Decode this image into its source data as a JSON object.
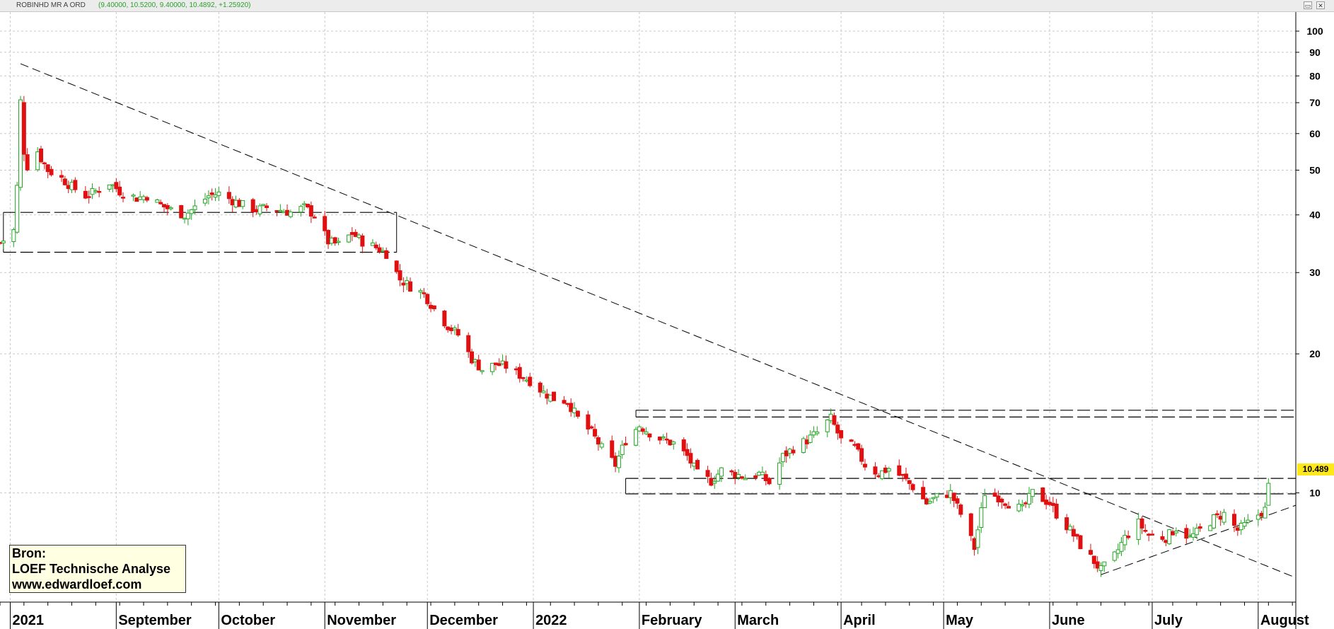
{
  "header": {
    "instrument": "ROBINHD MR A ORD",
    "ohlc_text": "(9.40000, 10.5200, 9.40000, 10.4892, +1.25920)"
  },
  "window_controls": {
    "restore": "▭",
    "close": "✕"
  },
  "source_box": {
    "line1": "Bron:",
    "line2": "LOEF Technische Analyse",
    "line3": "www.edwardloef.com"
  },
  "price_badge": "10.489",
  "colors": {
    "up": "#22a722",
    "down": "#e01010",
    "grid": "#c8c8c8",
    "annotation": "#000000",
    "badge": "#ffe81a",
    "source_bg": "#ffffe1"
  },
  "chart_data": {
    "type": "candlestick",
    "y_scale": "log",
    "ylim": [
      5.8,
      110
    ],
    "y_ticks": [
      {
        "value": 100,
        "label": "100"
      },
      {
        "value": 90,
        "label": "90"
      },
      {
        "value": 80,
        "label": "80"
      },
      {
        "value": 70,
        "label": "70"
      },
      {
        "value": 60,
        "label": "60"
      },
      {
        "value": 50,
        "label": "50"
      },
      {
        "value": 40,
        "label": "40"
      },
      {
        "value": 30,
        "label": "30"
      },
      {
        "value": 20,
        "label": "20"
      },
      {
        "value": 10,
        "label": "10"
      }
    ],
    "x_range": [
      "2021-07-29",
      "2022-08-12"
    ],
    "x_labels": [
      {
        "date": "2021-08-01",
        "label": "2021"
      },
      {
        "date": "2021-09-01",
        "label": "September"
      },
      {
        "date": "2021-10-01",
        "label": "October"
      },
      {
        "date": "2021-11-01",
        "label": "November"
      },
      {
        "date": "2021-12-01",
        "label": "December"
      },
      {
        "date": "2022-01-01",
        "label": "2022"
      },
      {
        "date": "2022-02-01",
        "label": "February"
      },
      {
        "date": "2022-03-01",
        "label": "March"
      },
      {
        "date": "2022-04-01",
        "label": "April"
      },
      {
        "date": "2022-05-01",
        "label": "May"
      },
      {
        "date": "2022-06-01",
        "label": "June"
      },
      {
        "date": "2022-07-01",
        "label": "July"
      },
      {
        "date": "2022-08-01",
        "label": "August"
      }
    ],
    "close_path": [
      [
        "2021-07-29",
        34.8
      ],
      [
        "2021-07-30",
        35.2
      ],
      [
        "2021-08-02",
        37.0
      ],
      [
        "2021-08-03",
        46.0
      ],
      [
        "2021-08-04",
        70.4
      ],
      [
        "2021-08-05",
        55.0
      ],
      [
        "2021-08-06",
        51.0
      ],
      [
        "2021-08-09",
        55.0
      ],
      [
        "2021-08-10",
        53.0
      ],
      [
        "2021-08-12",
        50.0
      ],
      [
        "2021-08-16",
        48.0
      ],
      [
        "2021-08-19",
        46.0
      ],
      [
        "2021-08-23",
        44.0
      ],
      [
        "2021-08-26",
        45.0
      ],
      [
        "2021-08-30",
        47.0
      ],
      [
        "2021-09-02",
        45.0
      ],
      [
        "2021-09-07",
        43.5
      ],
      [
        "2021-09-10",
        44.0
      ],
      [
        "2021-09-14",
        42.0
      ],
      [
        "2021-09-17",
        41.0
      ],
      [
        "2021-09-21",
        40.0
      ],
      [
        "2021-09-24",
        41.5
      ],
      [
        "2021-09-28",
        44.0
      ],
      [
        "2021-10-01",
        44.5
      ],
      [
        "2021-10-05",
        43.0
      ],
      [
        "2021-10-08",
        42.0
      ],
      [
        "2021-10-12",
        41.0
      ],
      [
        "2021-10-15",
        41.5
      ],
      [
        "2021-10-19",
        41.0
      ],
      [
        "2021-10-22",
        40.5
      ],
      [
        "2021-10-26",
        41.5
      ],
      [
        "2021-10-29",
        40.0
      ],
      [
        "2021-11-02",
        35.0
      ],
      [
        "2021-11-05",
        34.5
      ],
      [
        "2021-11-09",
        36.5
      ],
      [
        "2021-11-12",
        35.0
      ],
      [
        "2021-11-16",
        34.0
      ],
      [
        "2021-11-19",
        33.0
      ],
      [
        "2021-11-23",
        29.0
      ],
      [
        "2021-11-26",
        28.0
      ],
      [
        "2021-11-30",
        27.0
      ],
      [
        "2021-12-03",
        25.0
      ],
      [
        "2021-12-07",
        23.0
      ],
      [
        "2021-12-10",
        22.0
      ],
      [
        "2021-12-14",
        19.5
      ],
      [
        "2021-12-17",
        18.5
      ],
      [
        "2021-12-21",
        19.0
      ],
      [
        "2021-12-24",
        18.8
      ],
      [
        "2021-12-28",
        18.0
      ],
      [
        "2021-12-31",
        17.5
      ],
      [
        "2022-01-04",
        16.5
      ],
      [
        "2022-01-07",
        16.0
      ],
      [
        "2022-01-11",
        15.8
      ],
      [
        "2022-01-14",
        14.5
      ],
      [
        "2022-01-18",
        13.5
      ],
      [
        "2022-01-21",
        12.5
      ],
      [
        "2022-01-25",
        11.5
      ],
      [
        "2022-01-28",
        13.0
      ],
      [
        "2022-02-01",
        14.0
      ],
      [
        "2022-02-04",
        13.5
      ],
      [
        "2022-02-08",
        13.0
      ],
      [
        "2022-02-11",
        12.8
      ],
      [
        "2022-02-15",
        12.0
      ],
      [
        "2022-02-18",
        11.0
      ],
      [
        "2022-02-22",
        10.6
      ],
      [
        "2022-02-25",
        11.2
      ],
      [
        "2022-03-01",
        11.0
      ],
      [
        "2022-03-04",
        10.8
      ],
      [
        "2022-03-08",
        11.0
      ],
      [
        "2022-03-11",
        10.5
      ],
      [
        "2022-03-15",
        12.0
      ],
      [
        "2022-03-18",
        12.5
      ],
      [
        "2022-03-22",
        13.0
      ],
      [
        "2022-03-25",
        13.5
      ],
      [
        "2022-03-29",
        14.5
      ],
      [
        "2022-04-01",
        13.0
      ],
      [
        "2022-04-05",
        12.5
      ],
      [
        "2022-04-08",
        11.5
      ],
      [
        "2022-04-12",
        11.0
      ],
      [
        "2022-04-15",
        11.3
      ],
      [
        "2022-04-19",
        10.8
      ],
      [
        "2022-04-22",
        10.3
      ],
      [
        "2022-04-26",
        9.5
      ],
      [
        "2022-04-29",
        9.8
      ],
      [
        "2022-05-03",
        10.0
      ],
      [
        "2022-05-06",
        9.0
      ],
      [
        "2022-05-10",
        7.6
      ],
      [
        "2022-05-13",
        10.0
      ],
      [
        "2022-05-17",
        9.8
      ],
      [
        "2022-05-20",
        9.5
      ],
      [
        "2022-05-24",
        9.2
      ],
      [
        "2022-05-27",
        10.0
      ],
      [
        "2022-06-01",
        9.5
      ],
      [
        "2022-06-03",
        9.0
      ],
      [
        "2022-06-07",
        8.3
      ],
      [
        "2022-06-10",
        7.7
      ],
      [
        "2022-06-14",
        7.1
      ],
      [
        "2022-06-16",
        6.8
      ],
      [
        "2022-06-20",
        7.3
      ],
      [
        "2022-06-23",
        8.0
      ],
      [
        "2022-06-27",
        8.6
      ],
      [
        "2022-06-30",
        8.1
      ],
      [
        "2022-07-05",
        8.0
      ],
      [
        "2022-07-08",
        8.4
      ],
      [
        "2022-07-12",
        8.0
      ],
      [
        "2022-07-15",
        8.3
      ],
      [
        "2022-07-19",
        8.8
      ],
      [
        "2022-07-22",
        9.0
      ],
      [
        "2022-07-26",
        8.3
      ],
      [
        "2022-07-29",
        8.6
      ],
      [
        "2022-08-02",
        9.1
      ],
      [
        "2022-08-03",
        9.2
      ],
      [
        "2022-08-04",
        10.49
      ]
    ],
    "annotations": {
      "trendlines": [
        {
          "from": [
            "2021-08-04",
            85.0
          ],
          "to": [
            "2022-08-12",
            6.55
          ]
        },
        {
          "from": [
            "2022-06-16",
            6.65
          ],
          "to": [
            "2022-08-12",
            9.4
          ]
        }
      ],
      "boxes": [
        {
          "from": "2021-07-30",
          "to": "2021-11-22",
          "low": 33.2,
          "high": 40.5
        },
        {
          "from": "2022-01-28",
          "to": "2022-08-12",
          "low": 9.95,
          "high": 10.75
        },
        {
          "from": "2022-01-31",
          "to": "2022-08-12",
          "low": 14.6,
          "high": 15.1
        }
      ]
    },
    "last_price": 10.489
  }
}
